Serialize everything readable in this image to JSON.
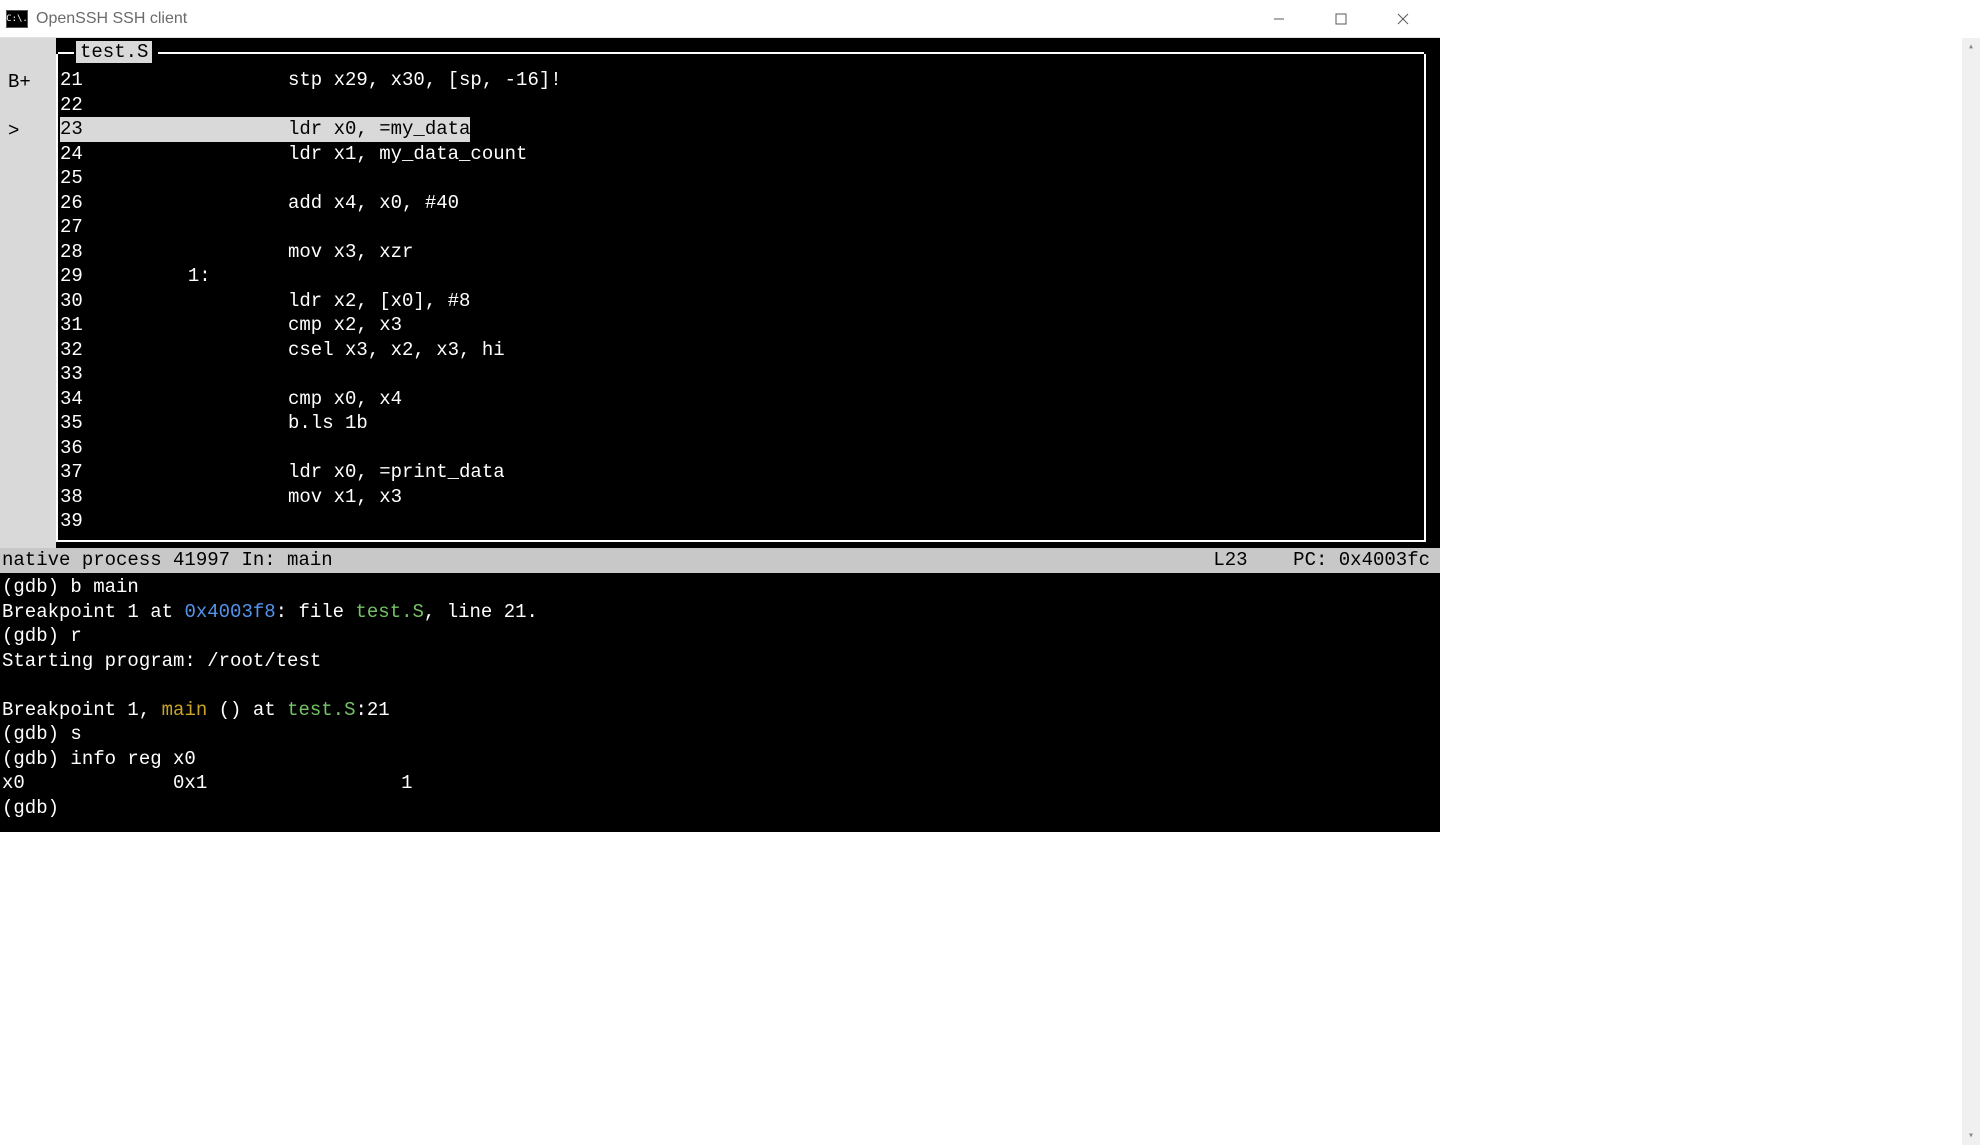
{
  "window": {
    "icon_text": "C:\\.",
    "title": "OpenSSH SSH client"
  },
  "source": {
    "title": "test.S",
    "gutter": [
      "B+",
      "",
      ">",
      "",
      "",
      "",
      "",
      "",
      "",
      "",
      "",
      "",
      "",
      "",
      "",
      "",
      "",
      "",
      ""
    ],
    "lines": [
      {
        "num": "21",
        "label": "",
        "code": "stp x29, x30, [sp, -16]!",
        "hl": false
      },
      {
        "num": "22",
        "label": "",
        "code": "",
        "hl": false
      },
      {
        "num": "23",
        "label": "",
        "code": "ldr x0, =my_data",
        "hl": true
      },
      {
        "num": "24",
        "label": "",
        "code": "ldr x1, my_data_count",
        "hl": false
      },
      {
        "num": "25",
        "label": "",
        "code": "",
        "hl": false
      },
      {
        "num": "26",
        "label": "",
        "code": "add x4, x0, #40",
        "hl": false
      },
      {
        "num": "27",
        "label": "",
        "code": "",
        "hl": false
      },
      {
        "num": "28",
        "label": "",
        "code": "mov x3, xzr",
        "hl": false
      },
      {
        "num": "29",
        "label": "       1:",
        "code": "",
        "hl": false
      },
      {
        "num": "30",
        "label": "",
        "code": "ldr x2, [x0], #8",
        "hl": false
      },
      {
        "num": "31",
        "label": "",
        "code": "cmp x2, x3",
        "hl": false
      },
      {
        "num": "32",
        "label": "",
        "code": "csel x3, x2, x3, hi",
        "hl": false
      },
      {
        "num": "33",
        "label": "",
        "code": "",
        "hl": false
      },
      {
        "num": "34",
        "label": "",
        "code": "cmp x0, x4",
        "hl": false
      },
      {
        "num": "35",
        "label": "",
        "code": "b.ls 1b",
        "hl": false
      },
      {
        "num": "36",
        "label": "",
        "code": "",
        "hl": false
      },
      {
        "num": "37",
        "label": "",
        "code": "ldr x0, =print_data",
        "hl": false
      },
      {
        "num": "38",
        "label": "",
        "code": "mov x1, x3",
        "hl": false
      },
      {
        "num": "39",
        "label": "",
        "code": "",
        "hl": false
      }
    ]
  },
  "status": {
    "left": "native process 41997 In: main",
    "right": "L23    PC: 0x4003fc"
  },
  "console": {
    "lines": [
      [
        {
          "t": "(gdb) b main",
          "c": ""
        }
      ],
      [
        {
          "t": "Breakpoint 1 at ",
          "c": ""
        },
        {
          "t": "0x4003f8",
          "c": "fg-blue"
        },
        {
          "t": ": file ",
          "c": ""
        },
        {
          "t": "test.S",
          "c": "fg-green"
        },
        {
          "t": ", line 21.",
          "c": ""
        }
      ],
      [
        {
          "t": "(gdb) r",
          "c": ""
        }
      ],
      [
        {
          "t": "Starting program: /root/test",
          "c": ""
        }
      ],
      [
        {
          "t": "",
          "c": ""
        }
      ],
      [
        {
          "t": "Breakpoint 1, ",
          "c": ""
        },
        {
          "t": "main",
          "c": "fg-yellow"
        },
        {
          "t": " () at ",
          "c": ""
        },
        {
          "t": "test.S",
          "c": "fg-green"
        },
        {
          "t": ":21",
          "c": ""
        }
      ],
      [
        {
          "t": "(gdb) s",
          "c": ""
        }
      ],
      [
        {
          "t": "(gdb) info reg x0",
          "c": ""
        }
      ],
      [
        {
          "t": "x0             0x1                 1",
          "c": ""
        }
      ],
      [
        {
          "t": "(gdb) ",
          "c": ""
        }
      ]
    ]
  }
}
